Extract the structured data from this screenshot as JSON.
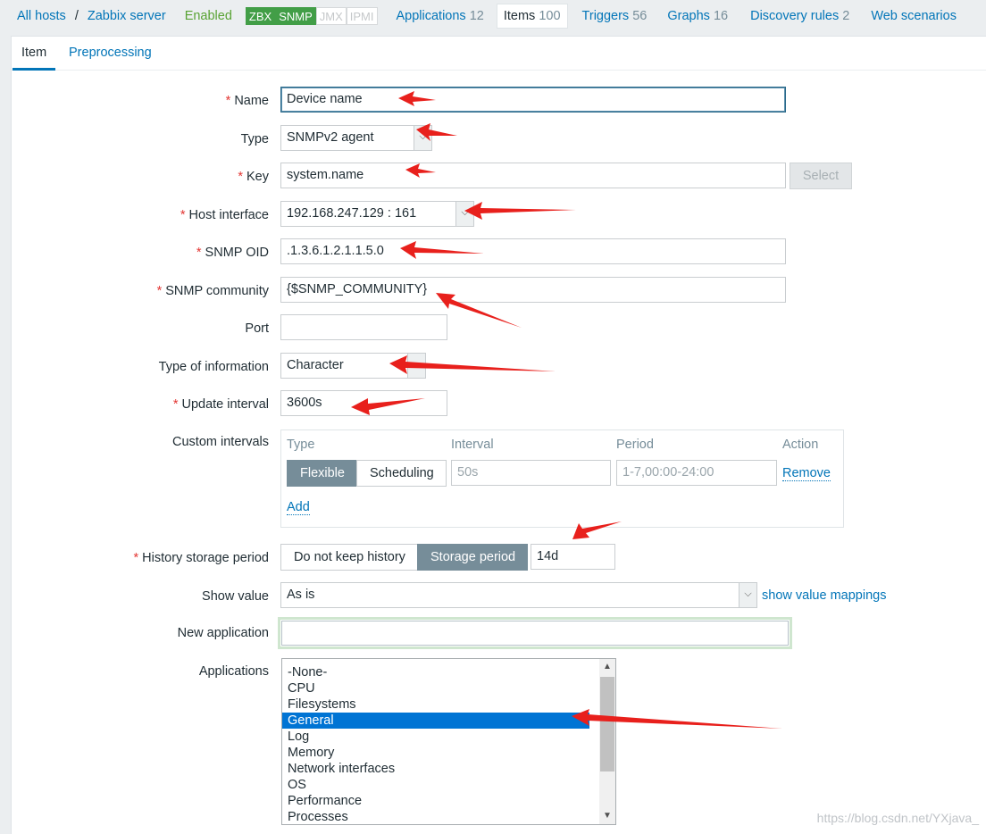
{
  "nav": {
    "all_hosts": "All hosts",
    "separator": "/",
    "host": "Zabbix server",
    "status": "Enabled",
    "badges": [
      "ZBX",
      "SNMP",
      "JMX",
      "IPMI"
    ],
    "applications": {
      "label": "Applications",
      "count": "12"
    },
    "items": {
      "label": "Items",
      "count": "100"
    },
    "triggers": {
      "label": "Triggers",
      "count": "56"
    },
    "graphs": {
      "label": "Graphs",
      "count": "16"
    },
    "discovery": {
      "label": "Discovery rules",
      "count": "2"
    },
    "web": {
      "label": "Web scenarios"
    }
  },
  "tabs": [
    "Item",
    "Preprocessing"
  ],
  "form": {
    "name": {
      "label": "Name",
      "value": "Device name"
    },
    "type": {
      "label": "Type",
      "value": "SNMPv2 agent"
    },
    "key": {
      "label": "Key",
      "value": "system.name",
      "button": "Select"
    },
    "host_interface": {
      "label": "Host interface",
      "value": "192.168.247.129 : 161"
    },
    "snmp_oid": {
      "label": "SNMP OID",
      "value": ".1.3.6.1.2.1.1.5.0"
    },
    "snmp_community": {
      "label": "SNMP community",
      "value": "{$SNMP_COMMUNITY}"
    },
    "port": {
      "label": "Port",
      "value": ""
    },
    "type_of_info": {
      "label": "Type of information",
      "value": "Character"
    },
    "update_interval": {
      "label": "Update interval",
      "value": "3600s"
    },
    "custom_intervals": {
      "label": "Custom intervals",
      "headers": [
        "Type",
        "Interval",
        "Period",
        "Action"
      ],
      "flexible": "Flexible",
      "scheduling": "Scheduling",
      "interval_placeholder": "50s",
      "period_placeholder": "1-7,00:00-24:00",
      "remove": "Remove",
      "add": "Add"
    },
    "history": {
      "label": "History storage period",
      "no_keep": "Do not keep history",
      "storage": "Storage period",
      "value": "14d"
    },
    "show_value": {
      "label": "Show value",
      "value": "As is",
      "link": "show value mappings"
    },
    "new_application": {
      "label": "New application",
      "value": ""
    },
    "applications": {
      "label": "Applications",
      "items": [
        "-None-",
        "CPU",
        "Filesystems",
        "General",
        "Log",
        "Memory",
        "Network interfaces",
        "OS",
        "Performance",
        "Processes"
      ],
      "selected": "General"
    }
  },
  "watermark": "https://blog.csdn.net/YXjava_",
  "colors": {
    "link": "#0275b8",
    "required": "#e33734",
    "enabled": "#59a334",
    "selected": "#0074d4",
    "annotation": "#e8201c"
  }
}
